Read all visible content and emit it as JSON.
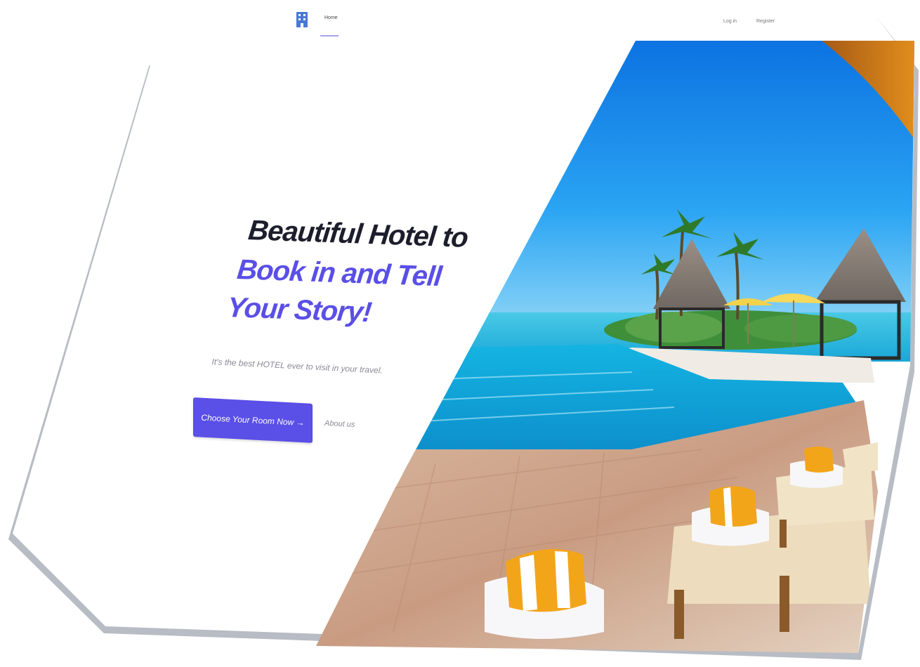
{
  "nav": {
    "home_label": "Home",
    "login_label": "Log in",
    "register_label": "Register"
  },
  "hero": {
    "headline_line1": "Beautiful Hotel to",
    "headline_line2": "Book in and Tell",
    "headline_line3": "Your Story!",
    "tagline": "It's the best HOTEL ever to visit in your travel.",
    "cta_label": "Choose Your Room Now →",
    "about_label": "About us"
  },
  "colors": {
    "accent": "#5a4fe6",
    "headline_dark": "#1d1d2c",
    "muted_text": "#8a8a96",
    "sky": "#1f8fe8",
    "sea": "#2cc3e4"
  },
  "icons": {
    "logo": "hotel-building-icon"
  }
}
